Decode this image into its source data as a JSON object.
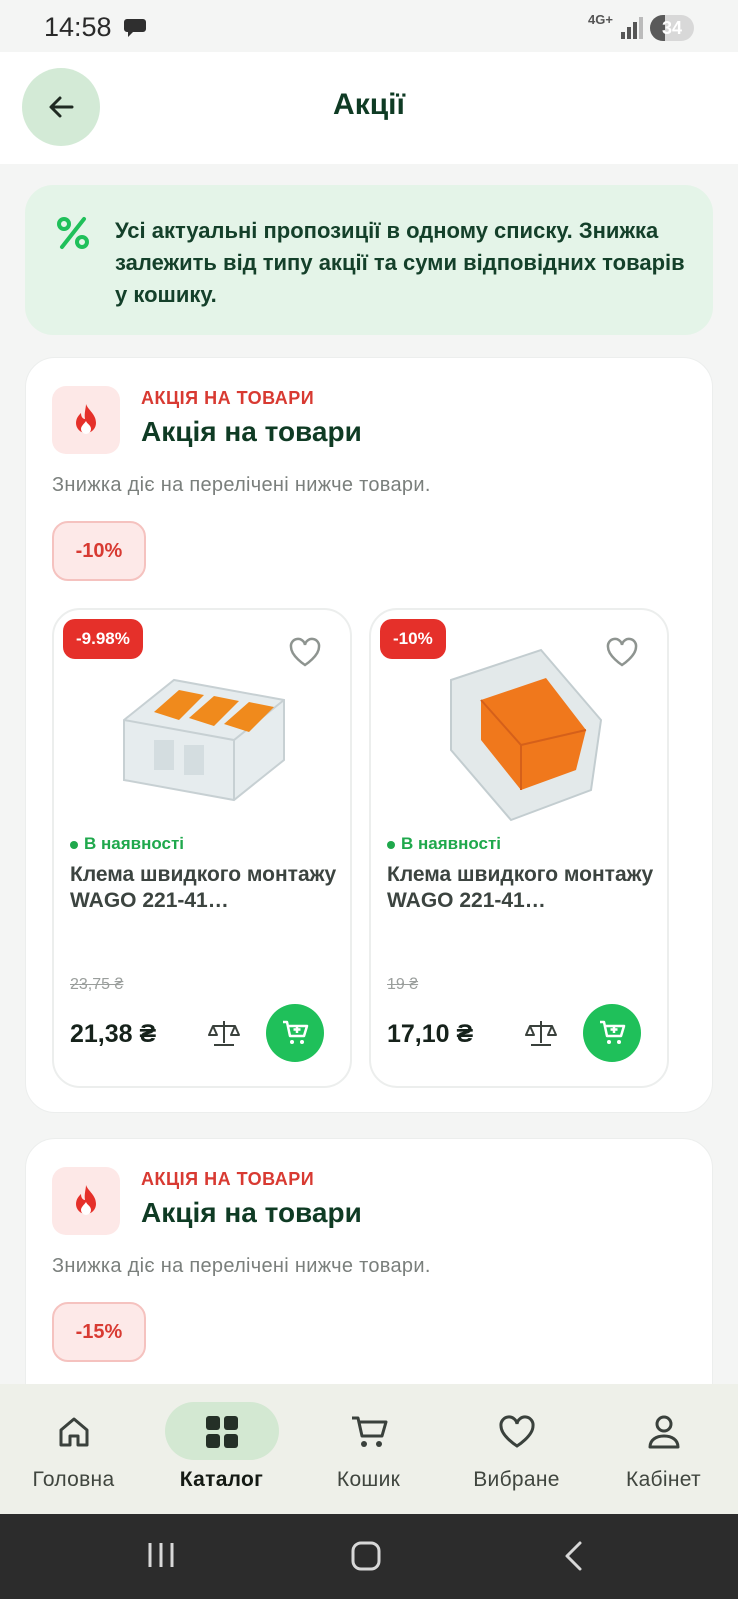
{
  "status_bar": {
    "time": "14:58",
    "network": "4G+",
    "battery": "34"
  },
  "header": {
    "title": "Акції"
  },
  "info": {
    "text": "Усі актуальні пропозиції в одному списку. Знижка залежить від типу акції та суми відповідних товарів у кошику."
  },
  "promos": [
    {
      "kicker": "АКЦІЯ НА ТОВАРИ",
      "title": "Акція на товари",
      "description": "Знижка діє на перелічені нижче товари.",
      "discount": "-10%",
      "products": [
        {
          "badge": "-9.98%",
          "stock": "В наявності",
          "name": "Клема швидкого монтажу WAGO 221-41…",
          "old_price": "23,75 ₴",
          "price": "21,38 ₴"
        },
        {
          "badge": "-10%",
          "stock": "В наявності",
          "name": "Клема швидкого монтажу WAGO 221-41…",
          "old_price": "19 ₴",
          "price": "17,10 ₴"
        }
      ]
    },
    {
      "kicker": "АКЦІЯ НА ТОВАРИ",
      "title": "Акція на товари",
      "description": "Знижка діє на перелічені нижче товари.",
      "discount": "-15%"
    }
  ],
  "nav": [
    {
      "label": "Головна",
      "icon": "home-icon"
    },
    {
      "label": "Каталог",
      "icon": "grid-icon",
      "active": true
    },
    {
      "label": "Кошик",
      "icon": "cart-icon"
    },
    {
      "label": "Вибране",
      "icon": "heart-icon"
    },
    {
      "label": "Кабінет",
      "icon": "user-icon"
    }
  ],
  "colors": {
    "brand_green": "#1fc05a",
    "dark_green": "#0f3b24",
    "sale_red": "#e5302a",
    "banner_bg": "#e4f4e8"
  }
}
